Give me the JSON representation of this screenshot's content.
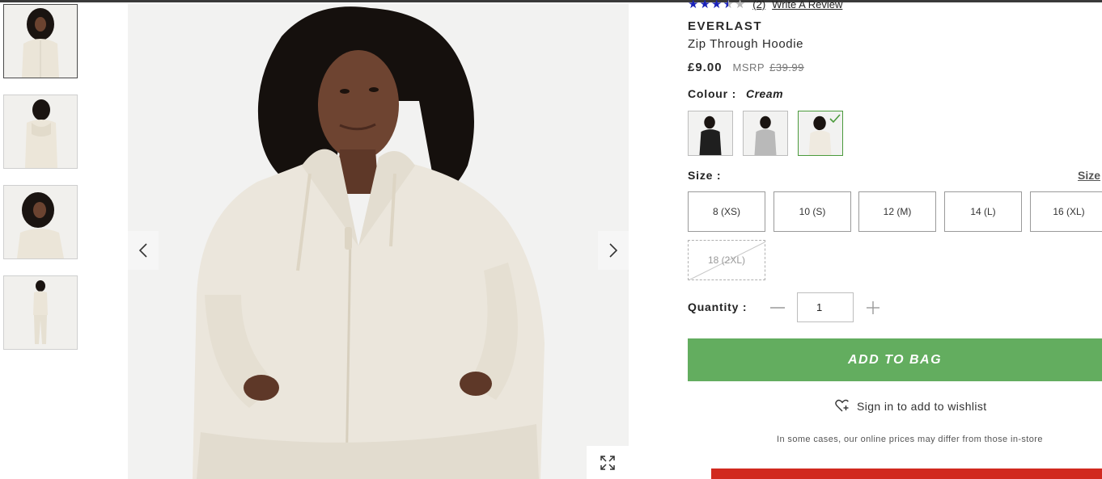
{
  "gallery": {
    "thumbnails": [
      {
        "alt": "front",
        "active": true
      },
      {
        "alt": "back",
        "active": false
      },
      {
        "alt": "side",
        "active": false
      },
      {
        "alt": "full",
        "active": false
      }
    ]
  },
  "product": {
    "rating_value": 3.5,
    "rating_max": 5,
    "review_count": "(2)",
    "write_review": "Write A Review",
    "brand": "EVERLAST",
    "name": "Zip Through Hoodie",
    "price": "£9.00",
    "msrp_label": "MSRP",
    "msrp_value": "£39.99",
    "colour_label": "Colour :",
    "colour_value": "Cream",
    "colours": [
      {
        "name": "Black",
        "hex": "#1f1f1f"
      },
      {
        "name": "Grey",
        "hex": "#b9b9b9"
      },
      {
        "name": "Cream",
        "hex": "#efeae0",
        "selected": true
      }
    ],
    "size_label": "Size :",
    "size_guide": "Size",
    "sizes": [
      {
        "label": "8 (XS)",
        "available": true
      },
      {
        "label": "10 (S)",
        "available": true
      },
      {
        "label": "12 (M)",
        "available": true
      },
      {
        "label": "14 (L)",
        "available": true
      },
      {
        "label": "16 (XL)",
        "available": true
      },
      {
        "label": "18 (2XL)",
        "available": false
      }
    ],
    "quantity_label": "Quantity :",
    "quantity_value": "1",
    "add_to_bag": "ADD TO BAG",
    "wishlist": "Sign in to add to wishlist",
    "disclaimer": "In some cases, our online prices may differ from those in-store"
  },
  "colors": {
    "accent_green": "#63ad5f",
    "star_blue": "#1a22b8",
    "cta_red": "#d1291f"
  },
  "icons": [
    "chevron-left-icon",
    "chevron-right-icon",
    "expand-icon",
    "heart-plus-icon",
    "minus-icon",
    "plus-icon",
    "check-icon"
  ]
}
